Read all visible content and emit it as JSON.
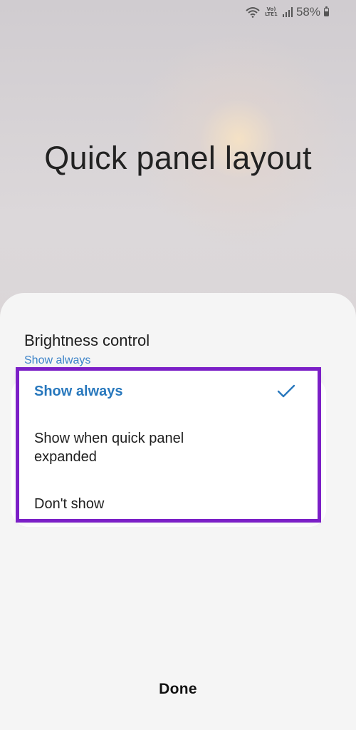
{
  "status_bar": {
    "volte_label": "Vo) LTE1",
    "battery_percent": "58%",
    "battery_level": 0.58,
    "icons": [
      "wifi-icon",
      "volte-lte-icon",
      "signal-icon",
      "battery-icon"
    ]
  },
  "page": {
    "title": "Quick panel layout"
  },
  "sheet": {
    "setting_title": "Brightness control",
    "setting_value": "Show always",
    "options": [
      {
        "label": "Show always",
        "selected": true
      },
      {
        "label": "Show when quick panel expanded",
        "selected": false
      },
      {
        "label": "Don't show",
        "selected": false
      }
    ],
    "done_label": "Done"
  },
  "colors": {
    "accent": "#2878bd",
    "highlight_outline": "#7b1fc7",
    "sheet_background": "#f5f5f5"
  }
}
